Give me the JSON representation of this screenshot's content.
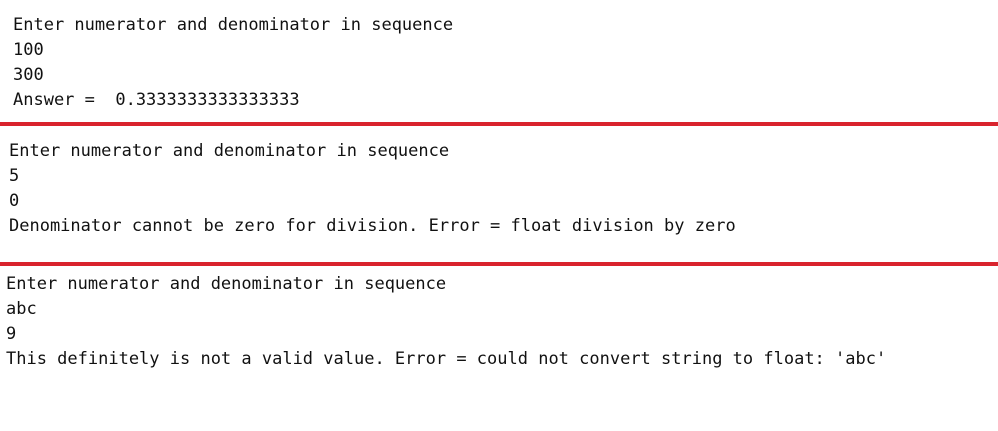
{
  "divider_color": "#d9232d",
  "panels": [
    {
      "lines": [
        "Enter numerator and denominator in sequence",
        "100",
        "300",
        "Answer =  0.3333333333333333"
      ]
    },
    {
      "lines": [
        "Enter numerator and denominator in sequence",
        "5",
        "0",
        "Denominator cannot be zero for division. Error = float division by zero"
      ]
    },
    {
      "lines": [
        "Enter numerator and denominator in sequence",
        "abc",
        "9",
        "This definitely is not a valid value. Error = could not convert string to float: 'abc'"
      ]
    }
  ]
}
